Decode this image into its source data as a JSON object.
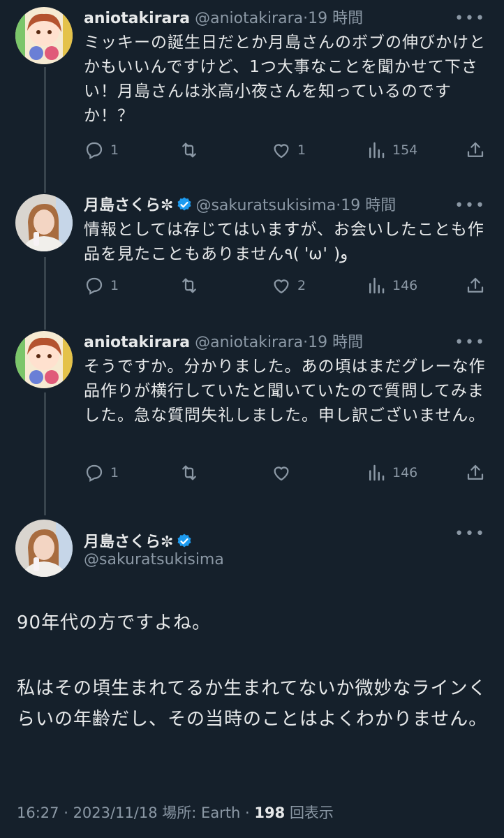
{
  "tweets": [
    {
      "name": "aniotakirara",
      "handle": "@aniotakirara",
      "sep": "·",
      "time": "19 時間",
      "more": "•••",
      "text": "ミッキーの誕生日だとか月島さんのボブの伸びかけとかもいいんですけど、1つ大事なことを聞かせて下さい！月島さんは氷高小夜さんを知っているのですか！？",
      "replies": "1",
      "retweets": "",
      "likes": "1",
      "views": "154",
      "verified": false
    },
    {
      "name": "月島さくら✼",
      "handle": "@sakuratsukisima",
      "sep": "·",
      "time": "19 時間",
      "more": "•••",
      "text": "情報としては存じてはいますが、お会いしたことも作品を見たこともありません٩( 'ω' )و",
      "replies": "1",
      "retweets": "",
      "likes": "2",
      "views": "146",
      "verified": true
    },
    {
      "name": "aniotakirara",
      "handle": "@aniotakirara",
      "sep": "·",
      "time": "19 時間",
      "more": "•••",
      "text": "そうですか。分かりました。あの頃はまだグレーな作品作りが横行していたと聞いていたので質問してみました。急な質問失礼しました。申し訳ございません。",
      "replies": "1",
      "retweets": "",
      "likes": "",
      "views": "146",
      "verified": false
    }
  ],
  "main": {
    "name": "月島さくら✼",
    "handle": "@sakuratsukisima",
    "more": "•••",
    "paragraph1": "90年代の方ですよね。",
    "paragraph2": "私はその頃生まれてるか生まれてないか微妙なラインくらいの年齢だし、その当時のことはよくわかりません。",
    "time": "16:27",
    "date": "2023/11/18",
    "location": "場所: Earth",
    "views_count": "198",
    "views_label": "回表示"
  },
  "colors": {
    "background": "#15202b",
    "text": "#e7e9ea",
    "muted": "#8b98a5",
    "verified": "#1d9bf0",
    "thread_line": "#38444d"
  }
}
